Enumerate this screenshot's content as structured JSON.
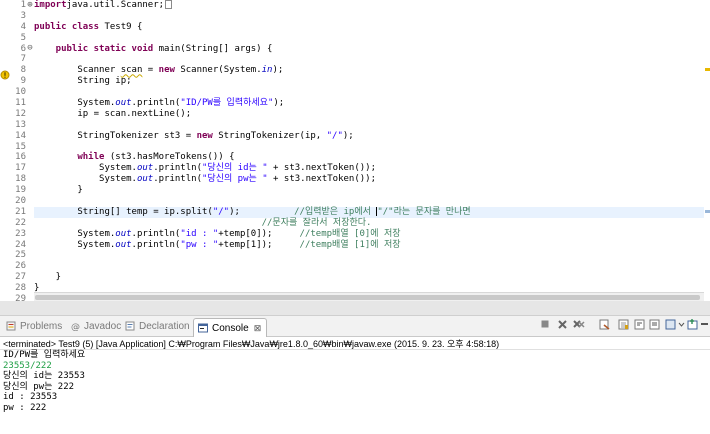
{
  "editor": {
    "line_numbers": [
      "1",
      "3",
      "4",
      "5",
      "6",
      "7",
      "8",
      "9",
      "10",
      "11",
      "12",
      "13",
      "14",
      "15",
      "16",
      "17",
      "18",
      "19",
      "20",
      "21",
      "22",
      "23",
      "24",
      "25",
      "26",
      "27",
      "28",
      "29"
    ],
    "fold_expand": "⊕",
    "fold_collapse": "⊖",
    "lines": [
      [
        [
          "kw",
          "import"
        ],
        [
          "",
          "java.util.Scanner;"
        ],
        [
          "box",
          ""
        ]
      ],
      [],
      [
        [
          "kw",
          "public class"
        ],
        [
          "",
          " Test9 {"
        ]
      ],
      [],
      [
        [
          "",
          ""
        ],
        [
          "kw",
          "    public static void"
        ],
        [
          "",
          " main(String[] args) {"
        ]
      ],
      [],
      [
        [
          "",
          "        Scanner "
        ],
        [
          "warn",
          "scan"
        ],
        [
          "",
          " = "
        ],
        [
          "kw",
          "new"
        ],
        [
          "",
          " Scanner(System."
        ],
        [
          "stat",
          "in"
        ],
        [
          "",
          ");"
        ]
      ],
      [
        [
          "",
          "        String ip;"
        ]
      ],
      [],
      [
        [
          "",
          "        System."
        ],
        [
          "stat",
          "out"
        ],
        [
          "",
          ".println("
        ],
        [
          "st",
          "\"ID/PW를 입력하세요\""
        ],
        [
          "",
          ");"
        ]
      ],
      [
        [
          "",
          "        ip = scan.nextLine();"
        ]
      ],
      [],
      [
        [
          "",
          "        StringTokenizer st3 = "
        ],
        [
          "kw",
          "new"
        ],
        [
          "",
          " StringTokenizer(ip, "
        ],
        [
          "st",
          "\"/\""
        ],
        [
          "",
          ");"
        ]
      ],
      [],
      [
        [
          "kw",
          "        while"
        ],
        [
          "",
          " (st3.hasMoreTokens()) {"
        ]
      ],
      [
        [
          "",
          "            System."
        ],
        [
          "stat",
          "out"
        ],
        [
          "",
          ".println("
        ],
        [
          "st",
          "\"당신의 id는 \""
        ],
        [
          "",
          " + st3.nextToken());"
        ]
      ],
      [
        [
          "",
          "            System."
        ],
        [
          "stat",
          "out"
        ],
        [
          "",
          ".println("
        ],
        [
          "st",
          "\"당신의 pw는 \""
        ],
        [
          "",
          " + st3.nextToken());"
        ]
      ],
      [
        [
          "",
          "        }"
        ]
      ],
      [],
      [
        [
          "",
          "        String[] temp = ip.split("
        ],
        [
          "st",
          "\"/\""
        ],
        [
          "",
          ");"
        ],
        [
          "cm",
          "          //입력받은 ip에서 "
        ],
        [
          "caret",
          ""
        ],
        [
          "cm",
          "\"/\"라는 문자를 만나면"
        ]
      ],
      [
        [
          "cm",
          "                                          //문자를 잘라서 저장한다."
        ]
      ],
      [
        [
          "",
          "        System."
        ],
        [
          "stat",
          "out"
        ],
        [
          "",
          ".println("
        ],
        [
          "st",
          "\"id : \""
        ],
        [
          "",
          "+temp[0]);"
        ],
        [
          "cm",
          "     //temp배열 [0]에 저장"
        ]
      ],
      [
        [
          "",
          "        System."
        ],
        [
          "stat",
          "out"
        ],
        [
          "",
          ".println("
        ],
        [
          "st",
          "\"pw : \""
        ],
        [
          "",
          "+temp[1]);"
        ],
        [
          "cm",
          "     //temp배열 [1]에 저장"
        ]
      ],
      [],
      [],
      [
        [
          "",
          "    }"
        ]
      ],
      [
        [
          "",
          "}"
        ]
      ],
      []
    ]
  },
  "views": {
    "tabs": [
      {
        "label": "Problems",
        "icon": "problems-icon"
      },
      {
        "label": "Javadoc",
        "icon": "javadoc-icon"
      },
      {
        "label": "Declaration",
        "icon": "declaration-icon"
      },
      {
        "label": "Console",
        "icon": "console-icon"
      }
    ],
    "close_glyph": "⊠"
  },
  "console": {
    "terminated": "<terminated> Test9 (5) [Java Application] C:₩Program Files₩Java₩jre1.8.0_60₩bin₩javaw.exe (2015. 9. 23. 오후 4:58:18)",
    "output": [
      {
        "text": "ID/PW를 입력하세요",
        "input": false
      },
      {
        "text": "23553/222",
        "input": true
      },
      {
        "text": "당신의 id는 23553",
        "input": false
      },
      {
        "text": "당신의 pw는 222",
        "input": false
      },
      {
        "text": "id : 23553",
        "input": false
      },
      {
        "text": "pw : 222",
        "input": false
      }
    ]
  },
  "colors": {
    "keyword": "#7f0055",
    "string": "#2a00ff",
    "comment": "#3f7f5f",
    "static_field": "#0000c0",
    "console_input": "#1e9e44",
    "current_line": "#e8f2fe"
  }
}
